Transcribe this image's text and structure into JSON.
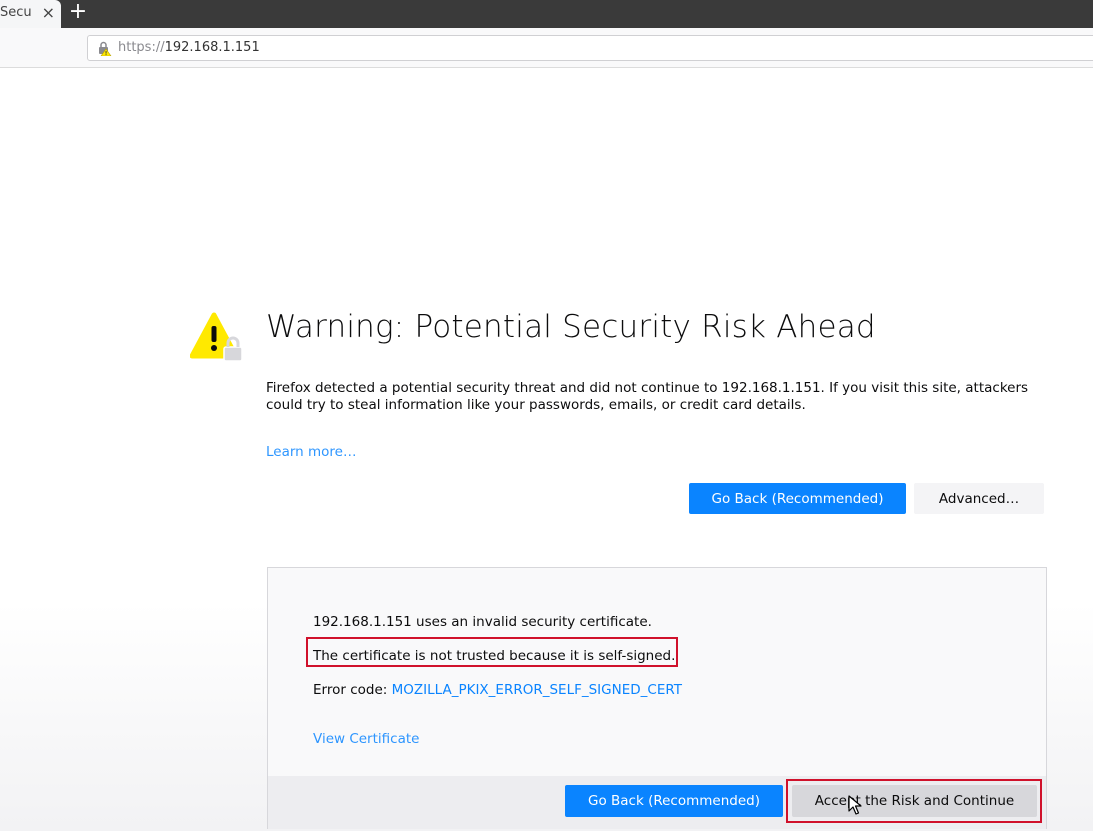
{
  "browser": {
    "tab_title": "Secu",
    "tab_close_glyph": "×",
    "new_tab_glyph": "+",
    "url_scheme": "https://",
    "url_host": "192.168.1.151",
    "url_icon": "lock-warning-icon"
  },
  "page": {
    "icon": "warning-icon",
    "title": "Warning: Potential Security Risk Ahead",
    "description": "Firefox detected a potential security threat and did not continue to 192.168.1.151. If you visit this site, attackers could try to steal information like your passwords, emails, or credit card details.",
    "learn_more": "Learn more…",
    "go_back_label": "Go Back (Recommended)",
    "advanced_label": "Advanced…"
  },
  "advanced_panel": {
    "invalid_cert_line": "192.168.1.151 uses an invalid security certificate.",
    "self_signed_line": "The certificate is not trusted because it is self-signed.",
    "error_code_prefix": "Error code: ",
    "error_code": "MOZILLA_PKIX_ERROR_SELF_SIGNED_CERT",
    "view_certificate": "View Certificate",
    "go_back_label": "Go Back (Recommended)",
    "accept_label": "Accept the Risk and Continue"
  },
  "colors": {
    "accent": "#0a84ff",
    "annotation": "#d0112b",
    "warning": "#ffe900"
  }
}
